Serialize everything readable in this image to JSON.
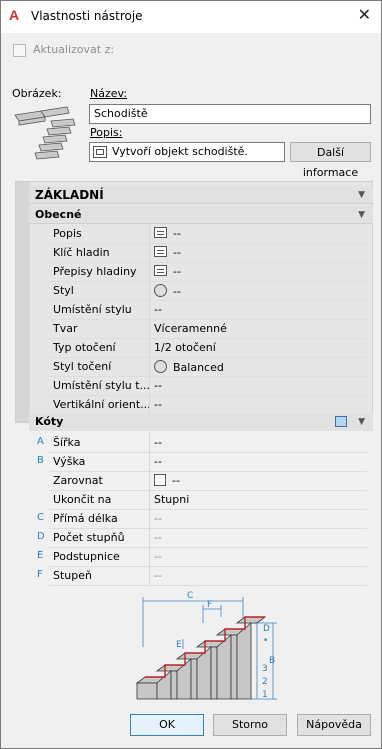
{
  "window": {
    "title": "Vlastnosti nástroje",
    "close_glyph": "✕"
  },
  "update": {
    "label": "Aktualizovat z:",
    "checked": false
  },
  "image_label": "Obrázek:",
  "name_label": "Název:",
  "name_value": "Schodiště",
  "desc_label": "Popis:",
  "desc_value": "Vytvoří objekt schodiště.",
  "more_info_button": "Další informace",
  "section_main": "ZÁKLADNÍ",
  "section_general": "Obecné",
  "general_props": [
    {
      "name": "Popis",
      "value": "--",
      "icon": "list-icon"
    },
    {
      "name": "Klíč hladin",
      "value": "--",
      "icon": "list-icon"
    },
    {
      "name": "Přepisy hladiny",
      "value": "--",
      "icon": "list-icon"
    },
    {
      "name": "Styl",
      "value": "--",
      "icon": "style-icon"
    },
    {
      "name": "Umístění stylu",
      "value": "--",
      "icon": ""
    },
    {
      "name": "Tvar",
      "value": "Víceramenné",
      "icon": ""
    },
    {
      "name": "Typ otočení",
      "value": "1/2 otočení",
      "icon": ""
    },
    {
      "name": "Styl točení",
      "value": "Balanced",
      "icon": "ball-icon"
    },
    {
      "name": "Umístění stylu t...",
      "value": "--",
      "icon": ""
    },
    {
      "name": "Vertikální orient...",
      "value": "--",
      "icon": ""
    }
  ],
  "section_dims": "Kóty",
  "dim_props": [
    {
      "letter": "A",
      "name": "Šířka",
      "value": "--",
      "disabled": false
    },
    {
      "letter": "B",
      "name": "Výška",
      "value": "--",
      "disabled": false
    },
    {
      "letter": "",
      "name": "Zarovnat",
      "value": "--",
      "disabled": false,
      "icon": "square-icon"
    },
    {
      "letter": "",
      "name": "Ukončit na",
      "value": "Stupni",
      "disabled": false
    },
    {
      "letter": "C",
      "name": "Přímá délka",
      "value": "--",
      "disabled": true
    },
    {
      "letter": "D",
      "name": "Počet stupňů",
      "value": "--",
      "disabled": true
    },
    {
      "letter": "E",
      "name": "Podstupnice",
      "value": "--",
      "disabled": true
    },
    {
      "letter": "F",
      "name": "Stupeň",
      "value": "--",
      "disabled": true
    }
  ],
  "diagram_labels": {
    "c": "C",
    "f": "F",
    "e": "E",
    "d": "D",
    "b": "B",
    "n3": "3",
    "n2": "2",
    "n1": "1",
    "dot": "•"
  },
  "buttons": {
    "ok": "OK",
    "cancel": "Storno",
    "help": "Nápověda"
  },
  "accent_color": "#2d7fc1",
  "app_icon_color": "#d32f2f"
}
